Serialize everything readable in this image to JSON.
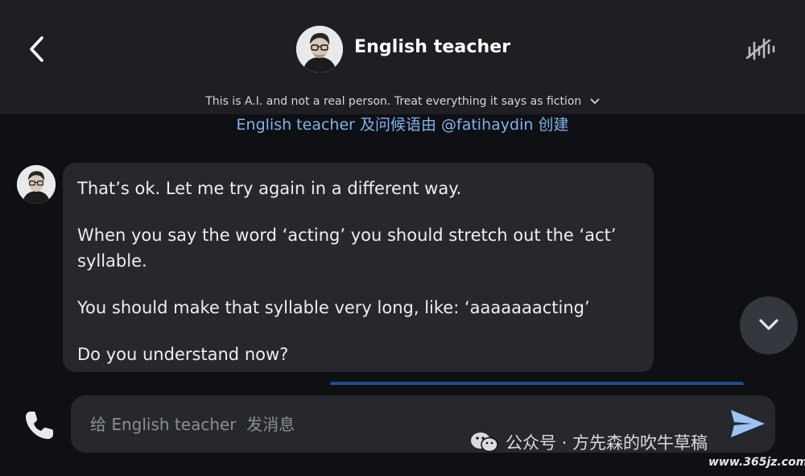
{
  "header": {
    "title": "English teacher",
    "back_icon": "chevron-left-icon",
    "voice_icon": "voice-waveform-icon"
  },
  "disclaimer": "This is A.I. and not a real person. Treat everything it says as fiction",
  "creator_line": "English teacher  及问候语由 @fatihaydin 创建",
  "message": {
    "paragraphs": [
      "That’s ok. Let me try again in a different way.",
      "When you say the word ‘acting’ you should stretch out the ‘act’ syllable.",
      "You should make that syllable very long, like: ‘aaaaaaacting’",
      "Do you understand now?"
    ]
  },
  "composer": {
    "placeholder": "给 English teacher  发消息",
    "value": ""
  },
  "watermark": {
    "text": "公众号 · 方先森的吹牛草稿",
    "site": "www.365jz.com"
  },
  "colors": {
    "header_bg": "#1d1f23",
    "bubble_bg": "#26282d",
    "link": "#7fb2ee",
    "user_bubble": "#1e4f86"
  }
}
